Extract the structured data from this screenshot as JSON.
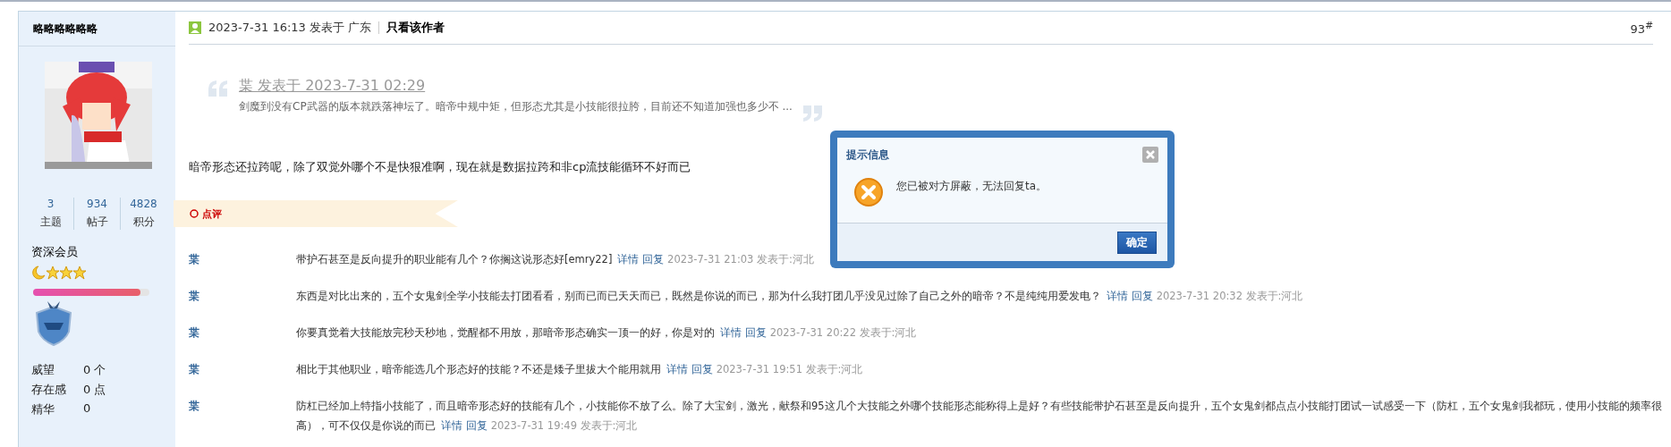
{
  "author": {
    "name": "略略略略略略",
    "stats": [
      {
        "value": "3",
        "label": "主题"
      },
      {
        "value": "934",
        "label": "帖子"
      },
      {
        "value": "4828",
        "label": "积分"
      }
    ],
    "group": "资深会员",
    "progress": {
      "level": 0.92
    },
    "fields": [
      {
        "label": "威望",
        "value": "0 个"
      },
      {
        "label": "存在感",
        "value": "0 点"
      },
      {
        "label": "精华",
        "value": "0"
      }
    ]
  },
  "post": {
    "date": "2023-7-31 16:13 发表于 广东",
    "author_only": "只看该作者",
    "floor": "93$^{#}$",
    "quote": {
      "title": "枼 发表于 2023-7-31 02:29",
      "text": "剑魔到没有CP武器的版本就跌落神坛了。暗帝中规中矩，但形态尤其是小技能很拉胯，目前还不知道加强也多少不 ..."
    },
    "body": "暗帝形态还拉跨呢，除了双觉外哪个不是快狠准啊，现在就是数据拉跨和非cp流技能循环不好而已",
    "comment_button": "点评",
    "comments": [
      {
        "author": "枼",
        "text": "带护石甚至是反向提升的职业能有几个？你搁这说形态好[emry22]",
        "detail": "详情",
        "reply": "回复",
        "time": "2023-7-31 21:03 发表于:河北"
      },
      {
        "author": "枼",
        "text": "东西是对比出来的，五个女鬼剑全学小技能去打团看看，别而已而已天天而已，既然是你说的而已，那为什么我打团几乎没见过除了自己之外的暗帝？不是纯纯用爱发电？",
        "detail": "详情",
        "reply": "回复",
        "time": "2023-7-31 20:32 发表于:河北"
      },
      {
        "author": "枼",
        "text": "你要真觉着大技能放完秒天秒地，觉醒都不用放，那暗帝形态确实一顶一的好，你是对的",
        "detail": "详情",
        "reply": "回复",
        "time": "2023-7-31 20:22 发表于:河北"
      },
      {
        "author": "枼",
        "text": "相比于其他职业，暗帝能选几个形态好的技能？不还是矮子里拔大个能用就用",
        "detail": "详情",
        "reply": "回复",
        "time": "2023-7-31 19:51 发表于:河北"
      },
      {
        "author": "枼",
        "text": "防杠已经加上特指小技能了，而且暗帝形态好的技能有几个，小技能你不放了么。除了大宝剑，激光，献祭和95这几个大技能之外哪个技能形态能称得上是好？有些技能带护石甚至是反向提升，五个女鬼剑都点点小技能打团试一试感受一下（防杠，五个女鬼剑我都玩，使用小技能的频率很高），可不仅仅是你说的而已",
        "detail": "详情",
        "reply": "回复",
        "time": "2023-7-31 19:49 发表于:河北"
      }
    ]
  },
  "dialog": {
    "title": "提示信息",
    "message": "您已被对方屏蔽，无法回复ta。",
    "ok": "确定"
  }
}
